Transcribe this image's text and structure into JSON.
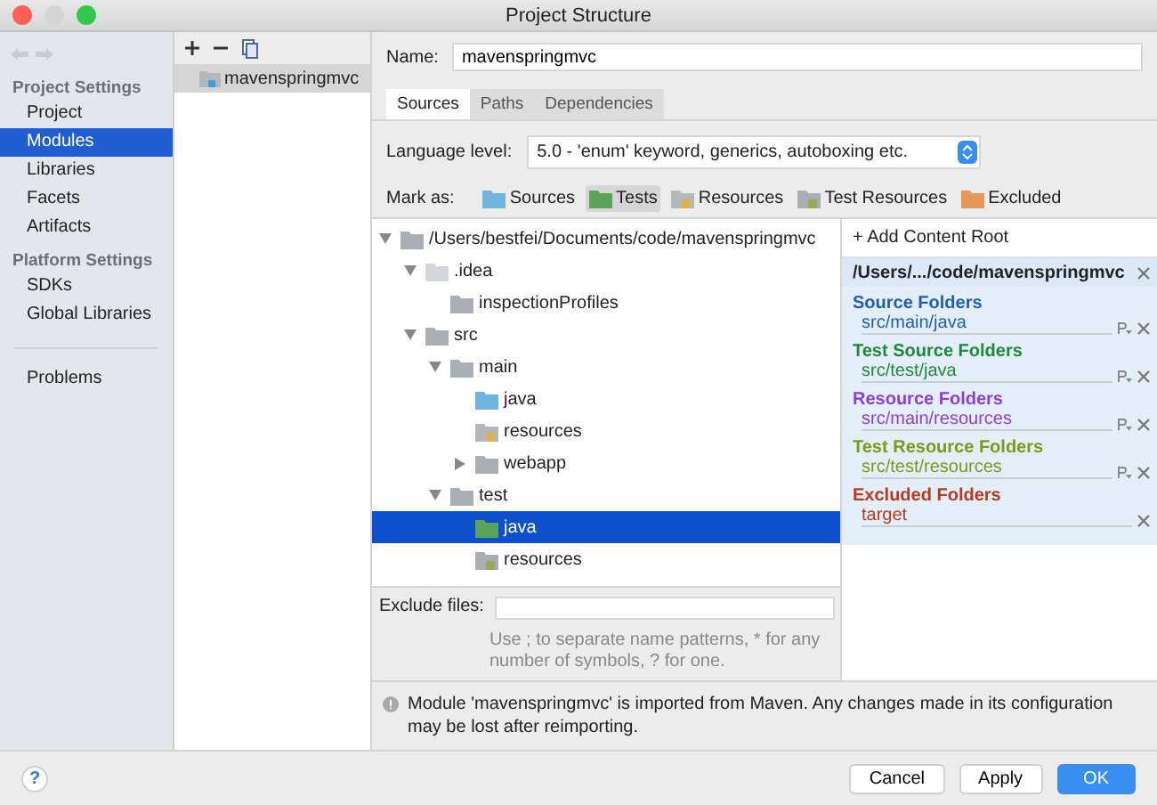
{
  "window": {
    "title": "Project Structure"
  },
  "sidebar": {
    "groups": [
      {
        "heading": "Project Settings",
        "items": [
          {
            "label": "Project",
            "selected": false
          },
          {
            "label": "Modules",
            "selected": true
          },
          {
            "label": "Libraries",
            "selected": false
          },
          {
            "label": "Facets",
            "selected": false
          },
          {
            "label": "Artifacts",
            "selected": false
          }
        ]
      },
      {
        "heading": "Platform Settings",
        "items": [
          {
            "label": "SDKs",
            "selected": false
          },
          {
            "label": "Global Libraries",
            "selected": false
          }
        ]
      }
    ],
    "extra_items": [
      {
        "label": "Problems",
        "selected": false
      }
    ]
  },
  "modules": {
    "items": [
      {
        "label": "mavenspringmvc",
        "selected": true
      }
    ]
  },
  "name_field": {
    "label": "Name:",
    "value": "mavenspringmvc"
  },
  "tabs": [
    {
      "label": "Sources",
      "selected": true
    },
    {
      "label": "Paths",
      "selected": false
    },
    {
      "label": "Dependencies",
      "selected": false
    }
  ],
  "language_level": {
    "label": "Language level:",
    "value": "5.0 - 'enum' keyword, generics, autoboxing etc."
  },
  "mark_as": {
    "label": "Mark as:",
    "buttons": [
      {
        "label": "Sources",
        "kind": "source",
        "selected": false
      },
      {
        "label": "Tests",
        "kind": "test",
        "selected": true
      },
      {
        "label": "Resources",
        "kind": "resource",
        "selected": false
      },
      {
        "label": "Test Resources",
        "kind": "test-resource",
        "selected": false
      },
      {
        "label": "Excluded",
        "kind": "excluded",
        "selected": false
      }
    ]
  },
  "tree": [
    {
      "label": "/Users/bestfei/Documents/code/mavenspringmvc",
      "kind": "plain",
      "expanded": true,
      "selected": false,
      "children": [
        {
          "label": ".idea",
          "kind": "faded",
          "expanded": true,
          "selected": false,
          "children": [
            {
              "label": "inspectionProfiles",
              "kind": "plain",
              "selected": false
            }
          ]
        },
        {
          "label": "src",
          "kind": "plain",
          "expanded": true,
          "selected": false,
          "children": [
            {
              "label": "main",
              "kind": "plain",
              "expanded": true,
              "selected": false,
              "children": [
                {
                  "label": "java",
                  "kind": "source",
                  "selected": false
                },
                {
                  "label": "resources",
                  "kind": "resource",
                  "selected": false
                },
                {
                  "label": "webapp",
                  "kind": "plain",
                  "expanded": false,
                  "selected": false
                }
              ]
            },
            {
              "label": "test",
              "kind": "plain",
              "expanded": true,
              "selected": false,
              "children": [
                {
                  "label": "java",
                  "kind": "test",
                  "selected": true
                },
                {
                  "label": "resources",
                  "kind": "test-resource",
                  "selected": false
                }
              ]
            }
          ]
        }
      ]
    }
  ],
  "exclude_files": {
    "label": "Exclude files:",
    "hint": "Use ; to separate name patterns, * for any number of symbols, ? for one."
  },
  "content_root": {
    "add_label": "+ Add Content Root",
    "path": "/Users/.../code/mavenspringmvc",
    "sections": [
      {
        "title": "Source Folders",
        "color": "#1f5fb4",
        "paths": [
          {
            "path": "src/main/java",
            "properties": true
          }
        ]
      },
      {
        "title": "Test Source Folders",
        "color": "#1f8a3a",
        "paths": [
          {
            "path": "src/test/java",
            "properties": true
          }
        ]
      },
      {
        "title": "Resource Folders",
        "color": "#8a3fd6",
        "paths": [
          {
            "path": "src/main/resources",
            "properties": true
          }
        ]
      },
      {
        "title": "Test Resource Folders",
        "color": "#7a9a1a",
        "paths": [
          {
            "path": "src/test/resources",
            "properties": true
          }
        ]
      },
      {
        "title": "Excluded Folders",
        "color": "#b83a1e",
        "paths": [
          {
            "path": "target",
            "properties": false
          }
        ]
      }
    ]
  },
  "info": "Module 'mavenspringmvc' is imported from Maven. Any changes made in its configuration may be lost after reimporting.",
  "help_button": "?",
  "buttons": [
    {
      "label": "Cancel",
      "kind": "normal"
    },
    {
      "label": "Apply",
      "kind": "normal"
    },
    {
      "label": "OK",
      "kind": "default"
    }
  ]
}
